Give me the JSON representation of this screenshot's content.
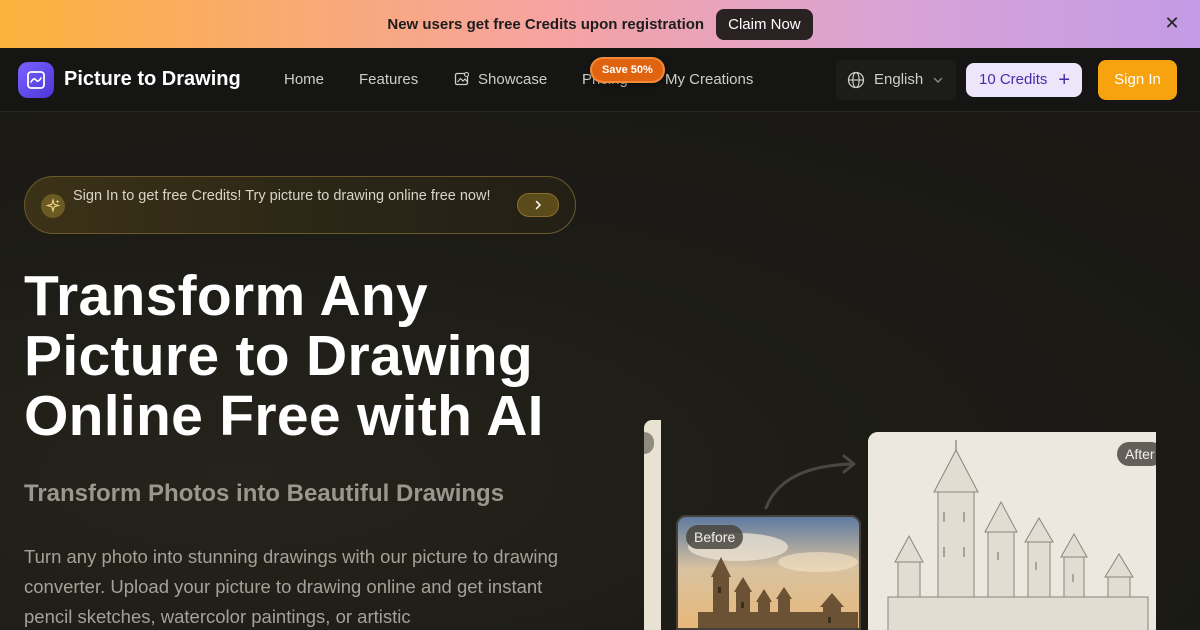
{
  "banner": {
    "text": "New users get free Credits upon registration",
    "cta": "Claim Now",
    "close": "✕"
  },
  "header": {
    "brand": "Picture to Drawing",
    "nav": [
      {
        "label": "Home"
      },
      {
        "label": "Features"
      },
      {
        "label": "Showcase",
        "icon": "showcase-icon"
      },
      {
        "label": "Pricing"
      },
      {
        "label": "My Creations"
      }
    ],
    "save_badge": "Save 50%",
    "language": "English",
    "credits": "10 Credits",
    "credits_plus": "+",
    "signin": "Sign In"
  },
  "hero": {
    "promo": "Sign In to get free Credits! Try picture to drawing online free now!",
    "title": "Transform Any Picture to Drawing Online Free with AI",
    "subtitle": "Transform Photos into Beautiful Drawings",
    "description": "Turn any photo into stunning drawings with our picture to drawing converter. Upload your picture to drawing online and get instant pencil sketches, watercolor paintings, or artistic"
  },
  "showcase": {
    "before_label": "Before",
    "after_label": "After"
  },
  "colors": {
    "accent": "#f7a20f",
    "brand_purple": "#5b45e0",
    "credits_bg": "#ede6fb",
    "badge_orange": "#e0640f"
  }
}
